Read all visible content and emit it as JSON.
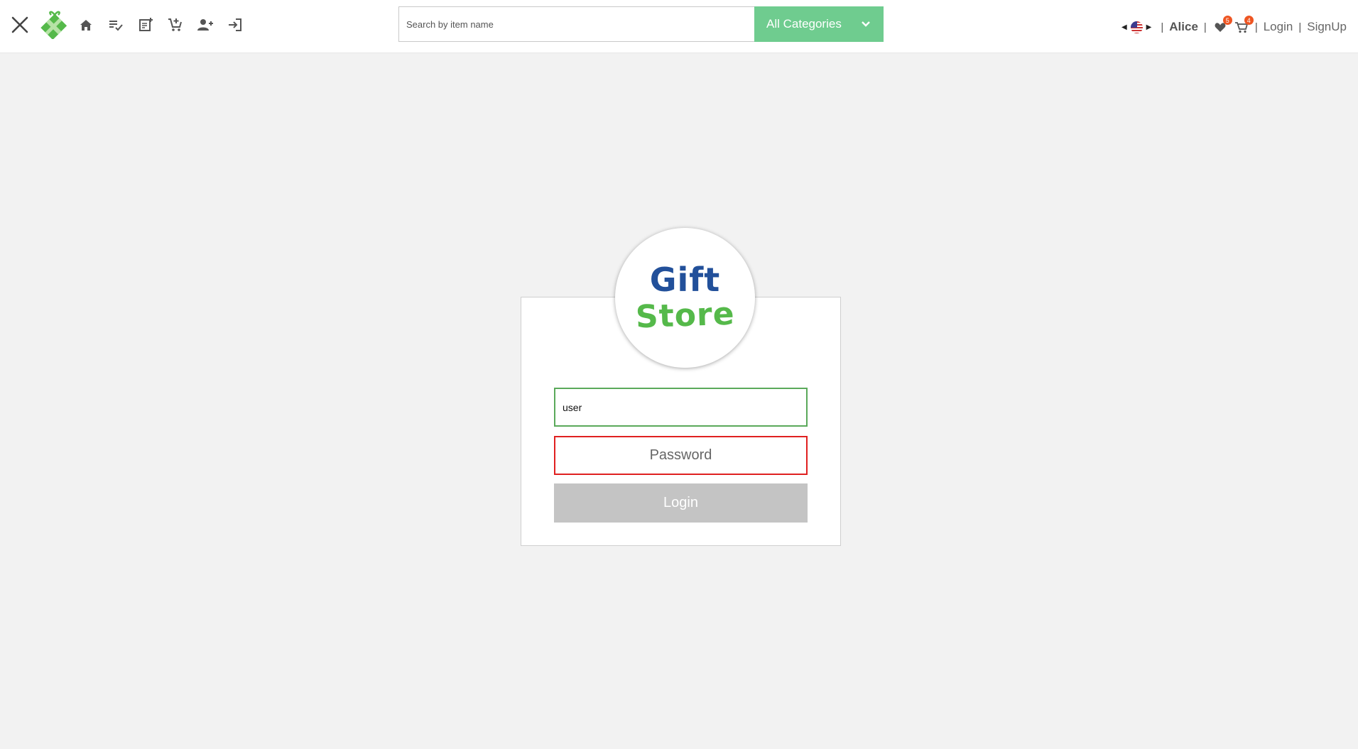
{
  "header": {
    "nav_icons": [
      "close-icon",
      "gift-logo-icon",
      "home-icon",
      "list-check-icon",
      "add-note-icon",
      "add-to-cart-icon",
      "add-user-icon",
      "sign-in-icon"
    ],
    "search": {
      "placeholder": "Search by item name",
      "value": ""
    },
    "category_select": {
      "selected": "All Categories"
    },
    "user": {
      "name": "Alice"
    },
    "wishlist": {
      "count": "5"
    },
    "cart": {
      "count": "4"
    },
    "separator": "|",
    "login_label": "Login",
    "signup_label": "SignUp",
    "language_icon": "us-flag-icon"
  },
  "login_form": {
    "logo": {
      "line1": "Gift",
      "line2": "Store"
    },
    "username": {
      "value": "user",
      "placeholder": ""
    },
    "password": {
      "value": "",
      "placeholder": "Password"
    },
    "submit_label": "Login"
  },
  "colors": {
    "accent_green": "#6fcc8f",
    "logo_blue": "#22509a",
    "logo_green": "#55b94a",
    "error_red": "#e02020",
    "badge_orange": "#ee5522",
    "disabled_gray": "#c4c4c4"
  }
}
